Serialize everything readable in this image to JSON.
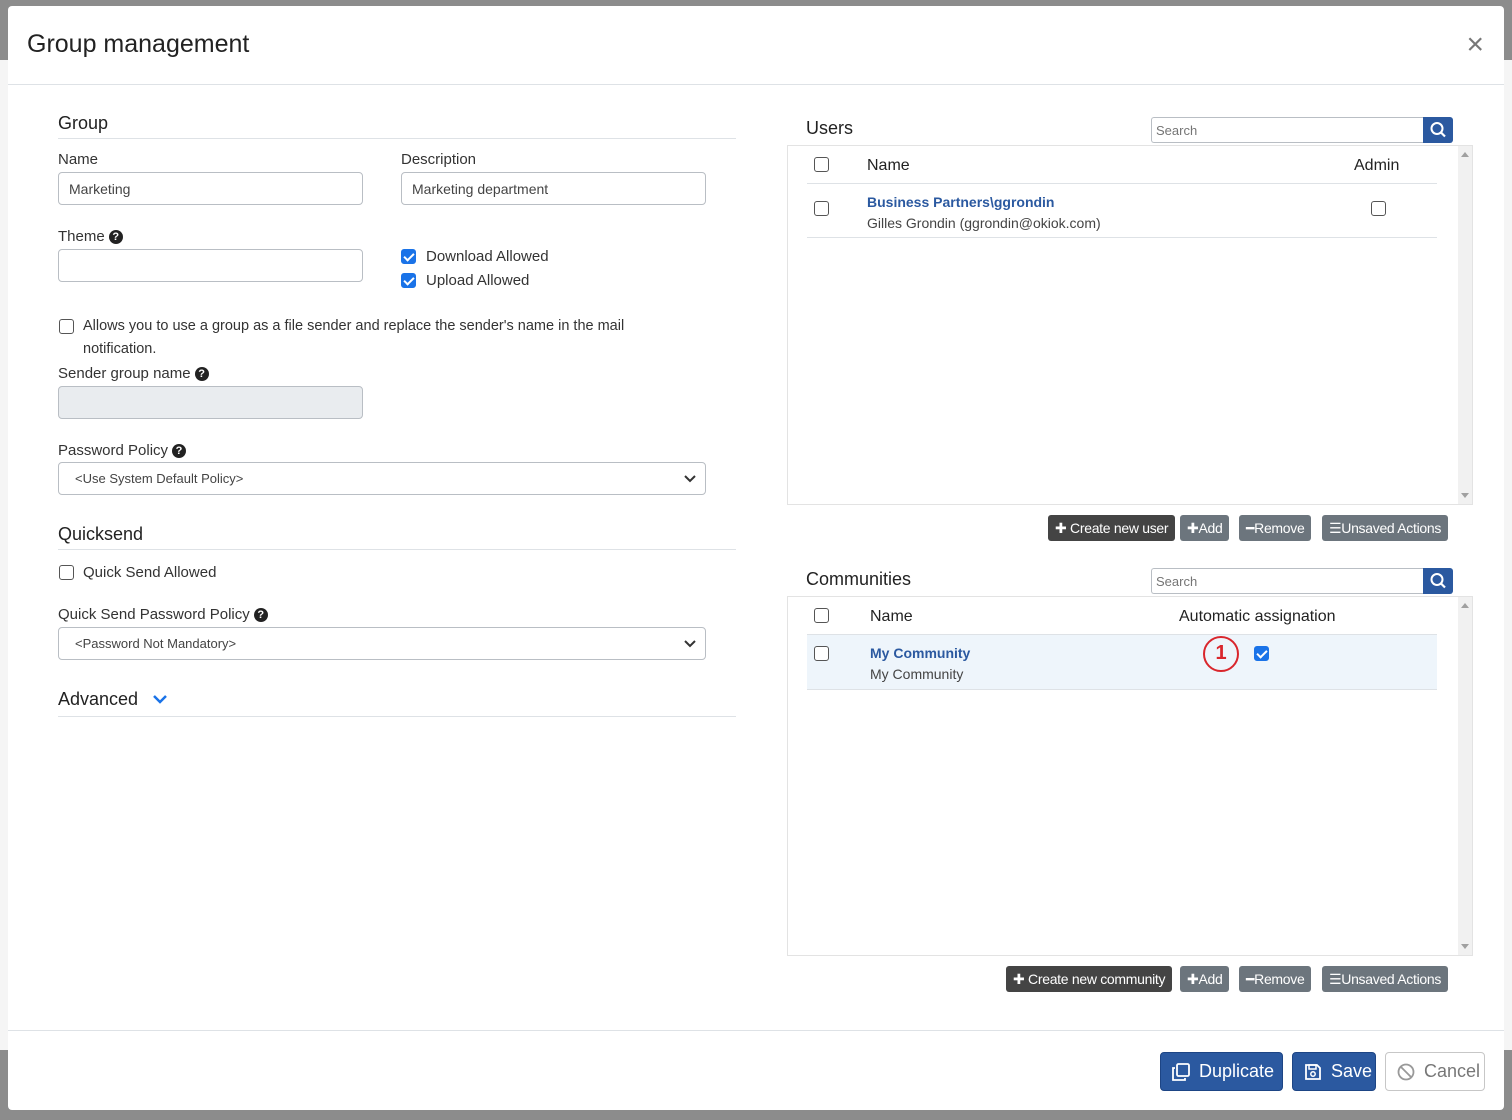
{
  "modal": {
    "title": "Group management",
    "close": "×"
  },
  "group": {
    "section_title": "Group",
    "name_label": "Name",
    "name_value": "Marketing",
    "description_label": "Description",
    "description_value": "Marketing department",
    "theme_label": "Theme",
    "theme_value": "",
    "download_allowed": {
      "label": "Download Allowed",
      "checked": true
    },
    "upload_allowed": {
      "label": "Upload Allowed",
      "checked": true
    },
    "sender_option": {
      "line1": "Allows you to use a group as a file sender and replace the sender's name in the mail",
      "line2": "notification.",
      "checked": false
    },
    "sender_group_name_label": "Sender group name",
    "sender_group_name_value": "",
    "password_policy_label": "Password Policy",
    "password_policy_value": "<Use System Default Policy>"
  },
  "quicksend": {
    "section_title": "Quicksend",
    "quick_send_allowed": {
      "label": "Quick Send Allowed",
      "checked": false
    },
    "password_policy_label": "Quick Send Password Policy",
    "password_policy_value": "<Password Not Mandatory>"
  },
  "advanced": {
    "section_title": "Advanced"
  },
  "users": {
    "title": "Users",
    "search_placeholder": "Search",
    "columns": {
      "name": "Name",
      "admin": "Admin"
    },
    "rows": [
      {
        "name": "Business Partners\\ggrondin",
        "detail": "Gilles Grondin (ggrondin@okiok.com)",
        "admin": false,
        "selected": false
      }
    ],
    "buttons": {
      "create": "Create new user",
      "add": "Add",
      "remove": "Remove",
      "unsaved": "Unsaved Actions"
    }
  },
  "communities": {
    "title": "Communities",
    "search_placeholder": "Search",
    "columns": {
      "name": "Name",
      "auto": "Automatic assignation"
    },
    "rows": [
      {
        "name": "My Community",
        "detail": "My Community",
        "auto": true,
        "selected": false
      }
    ],
    "annotation": "1",
    "buttons": {
      "create": "Create new community",
      "add": "Add",
      "remove": "Remove",
      "unsaved": "Unsaved Actions"
    }
  },
  "footer": {
    "duplicate": "Duplicate",
    "save": "Save",
    "cancel": "Cancel"
  },
  "colors": {
    "primary": "#2b59a0",
    "link": "#2b59a0",
    "annotation": "#d9262c",
    "checkbox": "#1a73e8"
  }
}
